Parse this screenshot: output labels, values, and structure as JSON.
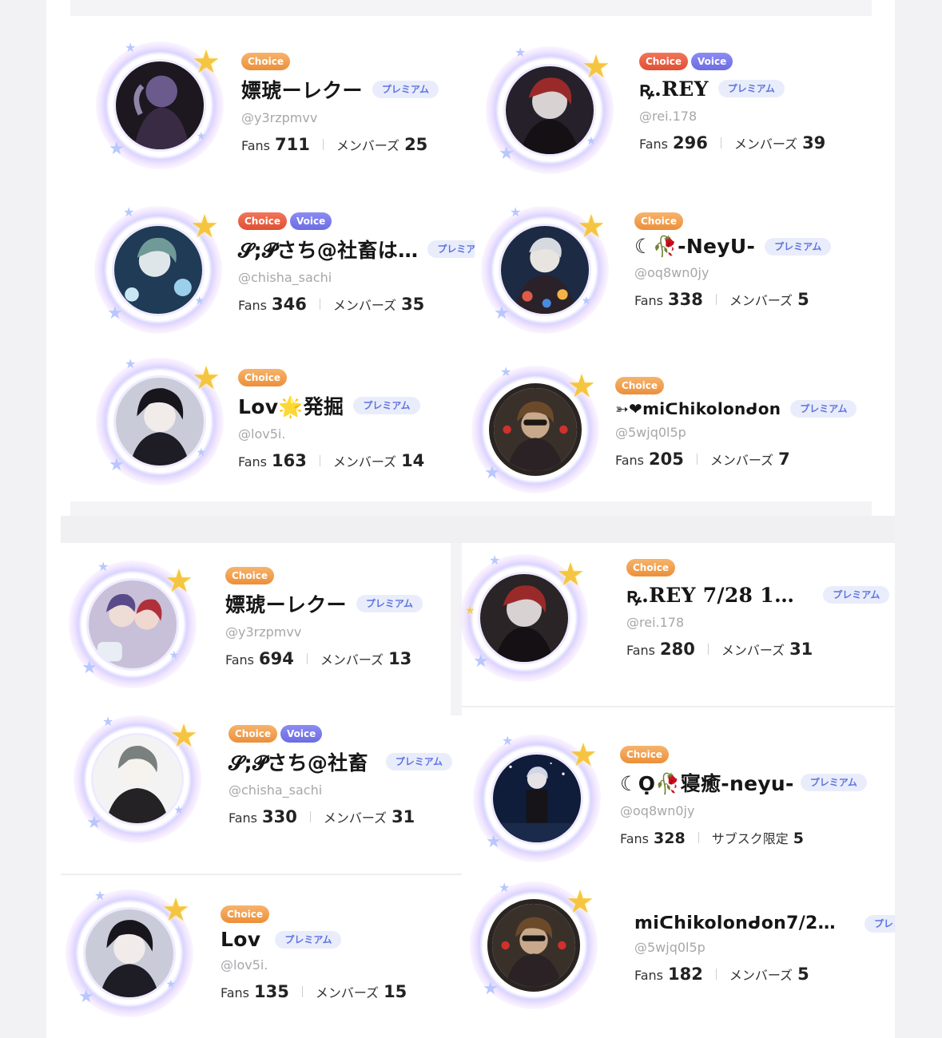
{
  "badges": {
    "choice": "Choice",
    "voice": "Voice",
    "premium": "プレミアム"
  },
  "stats": {
    "fans_label": "Fans",
    "members_label": "メンバーズ",
    "subscription_label": "サブスク限定"
  },
  "panel1": [
    {
      "name": "嫖琥ーレクー",
      "handle": "@y3rzpmvv",
      "fans": "711",
      "members": "25",
      "badges": [
        "choice"
      ]
    },
    {
      "name": "ꝶ.REY",
      "handle": "@rei.178",
      "fans": "296",
      "members": "39",
      "badges": [
        "choice",
        "voice"
      ]
    },
    {
      "name": "𝓢;𝓟さち@社畜は…",
      "handle": "@chisha_sachi",
      "fans": "346",
      "members": "35",
      "badges": [
        "choice",
        "voice"
      ]
    },
    {
      "name": "☾🥀-NeyU-",
      "handle": "@oq8wn0jy",
      "fans": "338",
      "members": "5",
      "badges": [
        "choice"
      ]
    },
    {
      "name": "Lov🌟発掘",
      "handle": "@lov5i.",
      "fans": "163",
      "members": "14",
      "badges": [
        "choice"
      ]
    },
    {
      "name": "➳❤miᑕhikolonᑯon",
      "handle": "@5wjq0l5p",
      "fans": "205",
      "members": "7",
      "badges": [
        "choice"
      ]
    }
  ],
  "panel2": [
    {
      "name": "嫖琥ーレクー",
      "handle": "@y3rzpmvv",
      "fans": "694",
      "members": "13",
      "badges": [
        "choice"
      ]
    },
    {
      "name": "ꝶ.REY 7/28 1…",
      "handle": "@rei.178",
      "fans": "280",
      "members": "31",
      "badges": [
        "choice"
      ]
    },
    {
      "name": "𝓢;𝓟さち@社畜",
      "handle": "@chisha_sachi",
      "fans": "330",
      "members": "31",
      "badges": [
        "choice",
        "voice"
      ]
    },
    {
      "name": "☾Ọ🥀寝癒-neyu-",
      "handle": "@oq8wn0jy",
      "fans": "328",
      "members": "5",
      "badges": [
        "choice"
      ],
      "members_mode": "subscription"
    },
    {
      "name": "Lov",
      "handle": "@lov5i.",
      "fans": "135",
      "members": "15",
      "badges": [
        "choice"
      ]
    },
    {
      "name": "miᑕhikolonᑯon7/2…",
      "handle": "@5wjq0l5p",
      "fans": "182",
      "members": "5",
      "badges": []
    }
  ],
  "premium_short": "プレミ",
  "colors": {
    "choice": "#ec8f3a",
    "choice_red": "#e04f33",
    "voice": "#6b6de2",
    "premium_text": "#5f74e0",
    "premium_bg": "#e9edfb"
  },
  "icons": {
    "frame_star": "star-icon",
    "avatar": "avatar"
  }
}
